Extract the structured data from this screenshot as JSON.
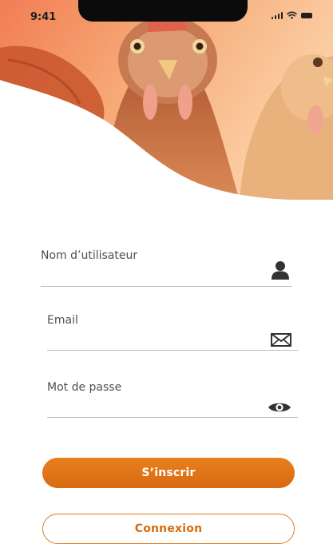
{
  "status_bar": {
    "time": "9:41"
  },
  "form": {
    "username": {
      "label": "Nom d’utilisateur",
      "icon": "user-icon"
    },
    "email": {
      "label": "Email",
      "icon": "envelope-icon"
    },
    "password": {
      "label": "Mot de passe",
      "icon": "eye-icon"
    }
  },
  "buttons": {
    "signup": "S’inscrir",
    "login": "Connexion"
  },
  "colors": {
    "accent": "#e27a20",
    "accent_dark": "#d86a10",
    "hero_light": "#f8caa0",
    "icon": "#333333"
  }
}
